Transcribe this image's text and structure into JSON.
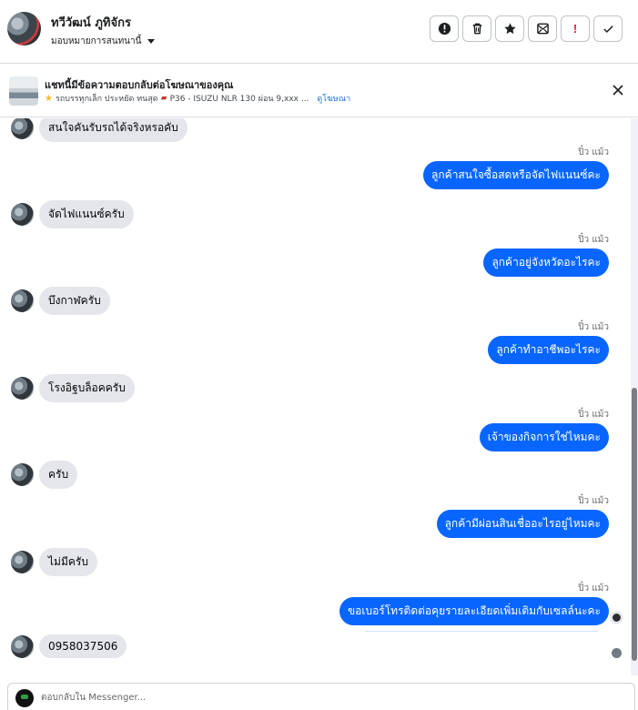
{
  "header": {
    "contact_name": "ทวีวัฒน์ ภูทิจักร",
    "assign_label": "มอบหมายการสนทนานี้",
    "actions": [
      {
        "name": "report-button",
        "icon": "alert-circle-icon"
      },
      {
        "name": "delete-button",
        "icon": "trash-icon"
      },
      {
        "name": "star-button",
        "icon": "star-icon"
      },
      {
        "name": "mark-unread-button",
        "icon": "envelope-icon"
      },
      {
        "name": "spam-button",
        "icon": "exclamation-icon",
        "text": "!"
      },
      {
        "name": "done-button",
        "icon": "check-icon"
      }
    ]
  },
  "ad": {
    "title": "แชทนี้มีข้อความตอบกลับต่อโฆษณาของคุณ",
    "subtitle": "รถบรรทุกเล็ก ประหยัด ทนสุด",
    "model": "P36 - ISUZU NLR 130 ผ่อน 9,xxx ...",
    "view_ad": "ดูโฆษณา"
  },
  "messages": [
    {
      "dir": "in",
      "text": "สนใจคันรับรถได้จริงหรอคับ"
    },
    {
      "dir": "out",
      "sender": "ปิ๋ว แม้ว",
      "text": "ลูกค้าสนใจซื้อสดหรือจัดไฟแนนซ์คะ"
    },
    {
      "dir": "in",
      "text": "จัดไฟแนนซ์ครับ"
    },
    {
      "dir": "out",
      "sender": "ปิ๋ว แม้ว",
      "text": "ลูกค้าอยู่จังหวัดอะไรคะ"
    },
    {
      "dir": "in",
      "text": "บึงกาฬครับ"
    },
    {
      "dir": "out",
      "sender": "ปิ๋ว แม้ว",
      "text": "ลูกค้าทำอาชีพอะไรคะ"
    },
    {
      "dir": "in",
      "text": "โรงอิฐบล็อคครับ"
    },
    {
      "dir": "out",
      "sender": "ปิ๋ว แม้ว",
      "text": "เจ้าของกิจการใช่ไหมคะ"
    },
    {
      "dir": "in",
      "text": "ครับ"
    },
    {
      "dir": "out",
      "sender": "ปิ๋ว แม้ว",
      "text": "ลูกค้ามีผ่อนสินเชื่ออะไรอยู่ไหมคะ"
    },
    {
      "dir": "in",
      "text": "ไม่มีครับ"
    },
    {
      "dir": "out",
      "sender": "ปิ๋ว แม้ว",
      "text": "ขอเบอร์โทรติดต่อคุยรายละเอียดเพิ่มเติมกับเซลล์นะคะ"
    },
    {
      "dir": "in",
      "text": "0958037506"
    }
  ],
  "composer": {
    "placeholder": "ตอบกลับใน Messenger..."
  },
  "colors": {
    "outgoing_bubble": "#0866ff",
    "incoming_bubble": "#e4e6eb",
    "link": "#216fdb",
    "danger": "#e4163a"
  }
}
